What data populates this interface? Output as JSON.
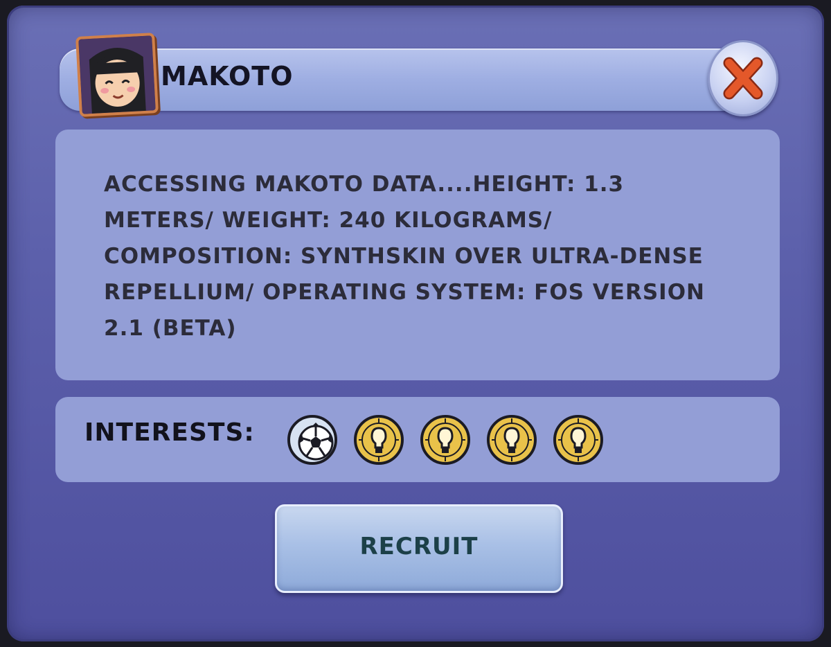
{
  "dialog": {
    "title": "MAKOTO",
    "description": "ACCESSING MAKOTO DATA....HEIGHT: 1.3 METERS/ WEIGHT: 240 KILOGRAMS/ COMPOSITION: SYNTHSKIN OVER ULTRA-DENSE REPELLIUM/ OPERATING SYSTEM: FOS VERSION 2.1 (BETA)",
    "interests_label": "INTERESTS:",
    "interests": [
      "soccer-ball-icon",
      "lightbulb-icon",
      "lightbulb-icon",
      "lightbulb-icon",
      "lightbulb-icon"
    ],
    "recruit_label": "RECRUIT"
  },
  "colors": {
    "frame": "#5c60ab",
    "panel": "#939ed6",
    "close_x": "#e4582a",
    "badge_gold": "#e9c24a"
  }
}
